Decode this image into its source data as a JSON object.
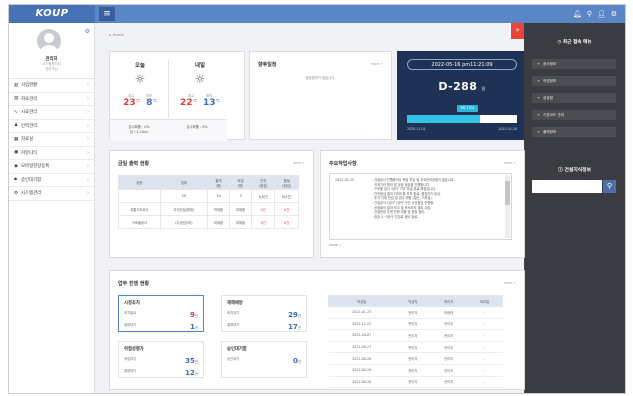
{
  "app": {
    "logo": "KOUP"
  },
  "topbar": {
    "menu_icon": "hamburger-icon",
    "icons": [
      "bell-icon",
      "location-icon",
      "user-icon",
      "settings-icon"
    ]
  },
  "profile": {
    "name": "관리자",
    "sub1": "시스템관리자",
    "sub2": "관리자님"
  },
  "nav": [
    {
      "label": "사업현황",
      "icon": "chart-icon"
    },
    {
      "label": "자료관리",
      "icon": "folder-icon"
    },
    {
      "label": "시료관리",
      "icon": "wave-icon"
    },
    {
      "label": "인력관리",
      "icon": "person-icon"
    },
    {
      "label": "자료실",
      "icon": "archive-icon"
    },
    {
      "label": "커뮤니티",
      "icon": "chat-icon"
    },
    {
      "label": "모바일현장등록",
      "icon": "mobile-icon"
    },
    {
      "label": "승인대기함",
      "icon": "inbox-icon"
    },
    {
      "label": "시스템관리",
      "icon": "gear-icon"
    }
  ],
  "breadcrumb": "Home",
  "weather": {
    "today": {
      "label": "오늘",
      "max_label": "최고",
      "min_label": "최저",
      "max": "23",
      "min": "8",
      "unit": "℃",
      "foot1": "강수확률 : 0%",
      "foot2": "남 / 3.2m/s"
    },
    "tomorrow": {
      "label": "내일",
      "max_label": "최고",
      "min_label": "최저",
      "max": "22",
      "min": "13",
      "unit": "℃",
      "foot1": "강수확률 : 0%"
    }
  },
  "schedule": {
    "title": "향후일정",
    "more": "more +",
    "empty": "일정정보가 없습니다."
  },
  "dday": {
    "datetime": "2022-05-16 pm11:21:09",
    "label": "D-288",
    "unit": "일",
    "progress_pct": 66.15,
    "pct_label": "66.15%",
    "start": "2020-11-01",
    "end": "2023-02-28"
  },
  "right_panel": {
    "title": "최근 접속 메뉴",
    "items": [
      "공사정보",
      "작업정보",
      "공유함",
      "기본코드 관리",
      "출력정보"
    ],
    "keyword_title": "건설지식정보",
    "search_placeholder": ""
  },
  "gold": {
    "title": "금일 출력 현황",
    "more": "more +",
    "headers": [
      "공종",
      "업체",
      "출역\n(명)",
      "작업\n(명)",
      "안전\n(점검)",
      "품질\n(점검)"
    ],
    "rows": [
      {
        "cells": [
          "",
          "29",
          "10",
          "3",
          "1(8건)",
          "0(4건)"
        ]
      },
      {
        "cells": [
          "공통기초공사",
          "우석건설(원청)",
          "미제출",
          "미제출",
          "0건",
          "0건"
        ]
      },
      {
        "cells": [
          "구조물공사",
          "(주)한양(하)",
          "미제출",
          "미제출",
          "0건",
          "0건"
        ]
      }
    ]
  },
  "notes": {
    "title": "주요작업사항",
    "more": "more +",
    "date": "2022-05-15",
    "text": "- 건설공사 진행중이나 현장 투입 및 주요관리공정이 없습니다.\n- 관계기관 협의 및 공정 점검을 진행합니다.\n- 구조물 공사 3공구 기초 타설 완료 예정입니다.\n- 안전점검 결과 지적사항 조치 완료, 품질관리 정상.\n- 추가 자재 반입 및 검수 예정 (철근, 거푸집).\n- 건설공사 1공구 2공구 구간 사전점검 진행중.\n- 공정회의 결과 보고 및 후속조치 계획 수립.\n- 건설현장 주변 민원 대응 및 현장 정리.\n- 현장 2~3공구 진입로 정비 완료.",
    "footer": "MORE +"
  },
  "progress": {
    "title": "업무 진행 현황",
    "more": "more +",
    "boxes": [
      {
        "title": "시정조치",
        "rows": [
          {
            "label": "조치필요",
            "value": "9",
            "unit": "건",
            "red": true
          },
          {
            "label": "결재대기",
            "value": "1",
            "unit": "건",
            "red": false
          }
        ]
      },
      {
        "title": "재해예방",
        "rows": [
          {
            "label": "조치대기",
            "value": "29",
            "unit": "건",
            "red": false
          },
          {
            "label": "결재대기",
            "value": "17",
            "unit": "건",
            "red": false
          }
        ]
      },
      {
        "title": "위험성평가",
        "rows": [
          {
            "label": "작성대기",
            "value": "35",
            "unit": "건",
            "red": false
          },
          {
            "label": "결재대기",
            "value": "12",
            "unit": "건",
            "red": false
          }
        ]
      },
      {
        "title": "승인대기함",
        "rows": [
          {
            "label": "승인대기",
            "value": "0",
            "unit": "건",
            "red": false
          }
        ]
      }
    ],
    "table_headers": [
      "작성일",
      "작성자",
      "처리자",
      "처리일"
    ],
    "table_rows": [
      [
        "2022-01-23",
        "관리자",
        "박현태",
        "-"
      ],
      [
        "2021-12-22",
        "관리자",
        "관리자",
        "-"
      ],
      [
        "2021-09-07",
        "관리자",
        "관리자",
        "-"
      ],
      [
        "2021-08-27",
        "관리자",
        "관리자",
        "-"
      ],
      [
        "2021-08-28",
        "관리자",
        "관리자",
        "-"
      ],
      [
        "2021-08-28",
        "관리자",
        "관리자",
        "-"
      ],
      [
        "2021-08-28",
        "관리자",
        "관리자",
        "-"
      ]
    ]
  }
}
